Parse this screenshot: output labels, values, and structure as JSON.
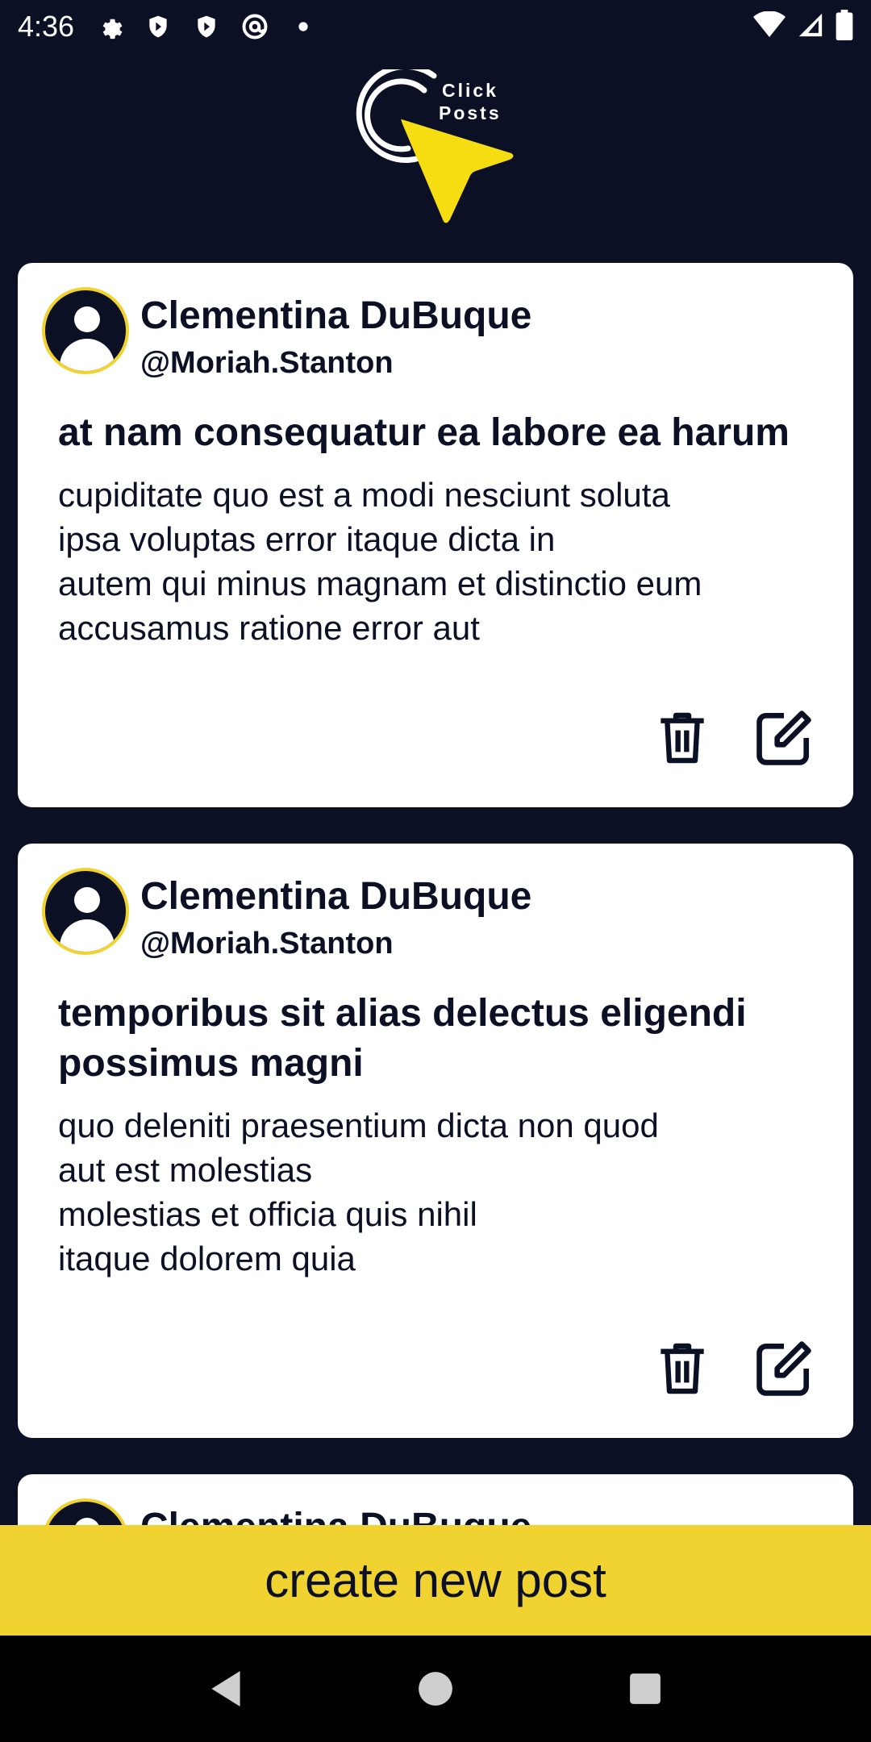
{
  "status_bar": {
    "time": "4:36",
    "icons": [
      "gear-icon",
      "shield-icon",
      "shield-icon",
      "at-sign-icon",
      "dot-icon",
      "wifi-icon",
      "signal-icon",
      "battery-icon"
    ]
  },
  "logo": {
    "line1": "Click",
    "line2": "Posts",
    "accent": "#f5dd12"
  },
  "posts": [
    {
      "author": "Clementina DuBuque",
      "handle": "@Moriah.Stanton",
      "title": "at nam consequatur ea labore ea harum",
      "body": "cupiditate quo est a modi nesciunt soluta\nipsa voluptas error itaque dicta in\nautem qui minus magnam et distinctio eum\naccusamus ratione error aut"
    },
    {
      "author": "Clementina DuBuque",
      "handle": "@Moriah.Stanton",
      "title": "temporibus sit alias delectus eligendi possimus magni",
      "body": "quo deleniti praesentium dicta non quod\naut est molestias\nmolestias et officia quis nihil\nitaque dolorem quia"
    },
    {
      "author": "Clementina DuBuque"
    }
  ],
  "create_button": {
    "label": "create new post"
  },
  "colors": {
    "background": "#0b1024",
    "card": "#ffffff",
    "accent": "#f0d330",
    "text": "#0b1024"
  }
}
